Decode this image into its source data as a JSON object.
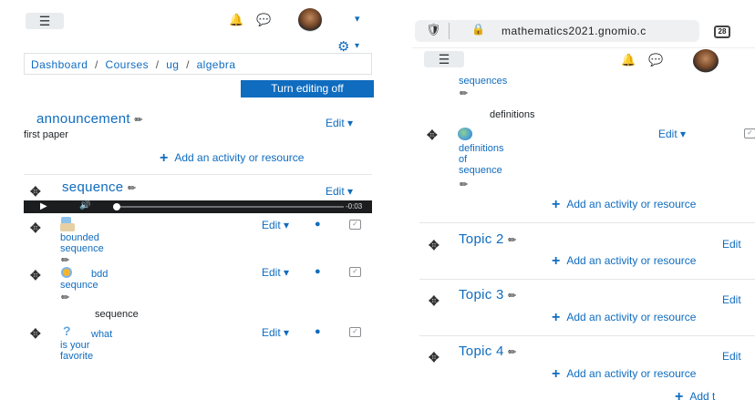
{
  "left": {
    "header": {
      "menu_icon": "hamburger-icon",
      "bell_icon": "bell-icon",
      "chat_icon": "chat-icon",
      "user_menu_caret": "▾"
    },
    "gear_caret": "▾",
    "breadcrumb": {
      "dashboard": "Dashboard",
      "courses": "Courses",
      "ug": "ug",
      "algebra": "algebra",
      "separator": "/"
    },
    "turn_editing_button": "Turn editing off",
    "sections": [
      {
        "title": "announcement",
        "edit_label": "Edit",
        "summary": "first paper",
        "add_label": "Add an activity or resource"
      },
      {
        "title": "sequence",
        "edit_label": "Edit",
        "audio_time": "-0:03",
        "activities": [
          {
            "name_lines": [
              "bounded",
              "sequence"
            ],
            "edit_label": "Edit"
          },
          {
            "name_lines": [
              "bdd",
              "sequnce"
            ],
            "edit_label": "Edit"
          },
          {
            "label": "sequence"
          },
          {
            "name_lines": [
              "what",
              "is your",
              "favorite"
            ],
            "edit_label": "Edit"
          }
        ]
      }
    ]
  },
  "right": {
    "browser": {
      "url": "mathematics2021.gnomio.c",
      "tab_count": "28"
    },
    "top_activity": {
      "name_lines": [
        "sequences"
      ]
    },
    "label_text": "definitions",
    "activity": {
      "name_lines": [
        "definitions",
        "of",
        "sequence"
      ],
      "edit_label": "Edit"
    },
    "add_label": "Add an activity or resource",
    "topics": [
      {
        "title": "Topic 2",
        "edit_label": "Edit",
        "add_label": "Add an activity or resource"
      },
      {
        "title": "Topic 3",
        "edit_label": "Edit",
        "add_label": "Add an activity or resource"
      },
      {
        "title": "Topic 4",
        "edit_label": "Edit",
        "add_label": "Add an activity or resource"
      }
    ],
    "bottom_add_label": "Add t"
  },
  "colors": {
    "link": "#0f6cbf",
    "primary_button": "#0f6cbf",
    "audio_bar": "#1b1d1f"
  }
}
